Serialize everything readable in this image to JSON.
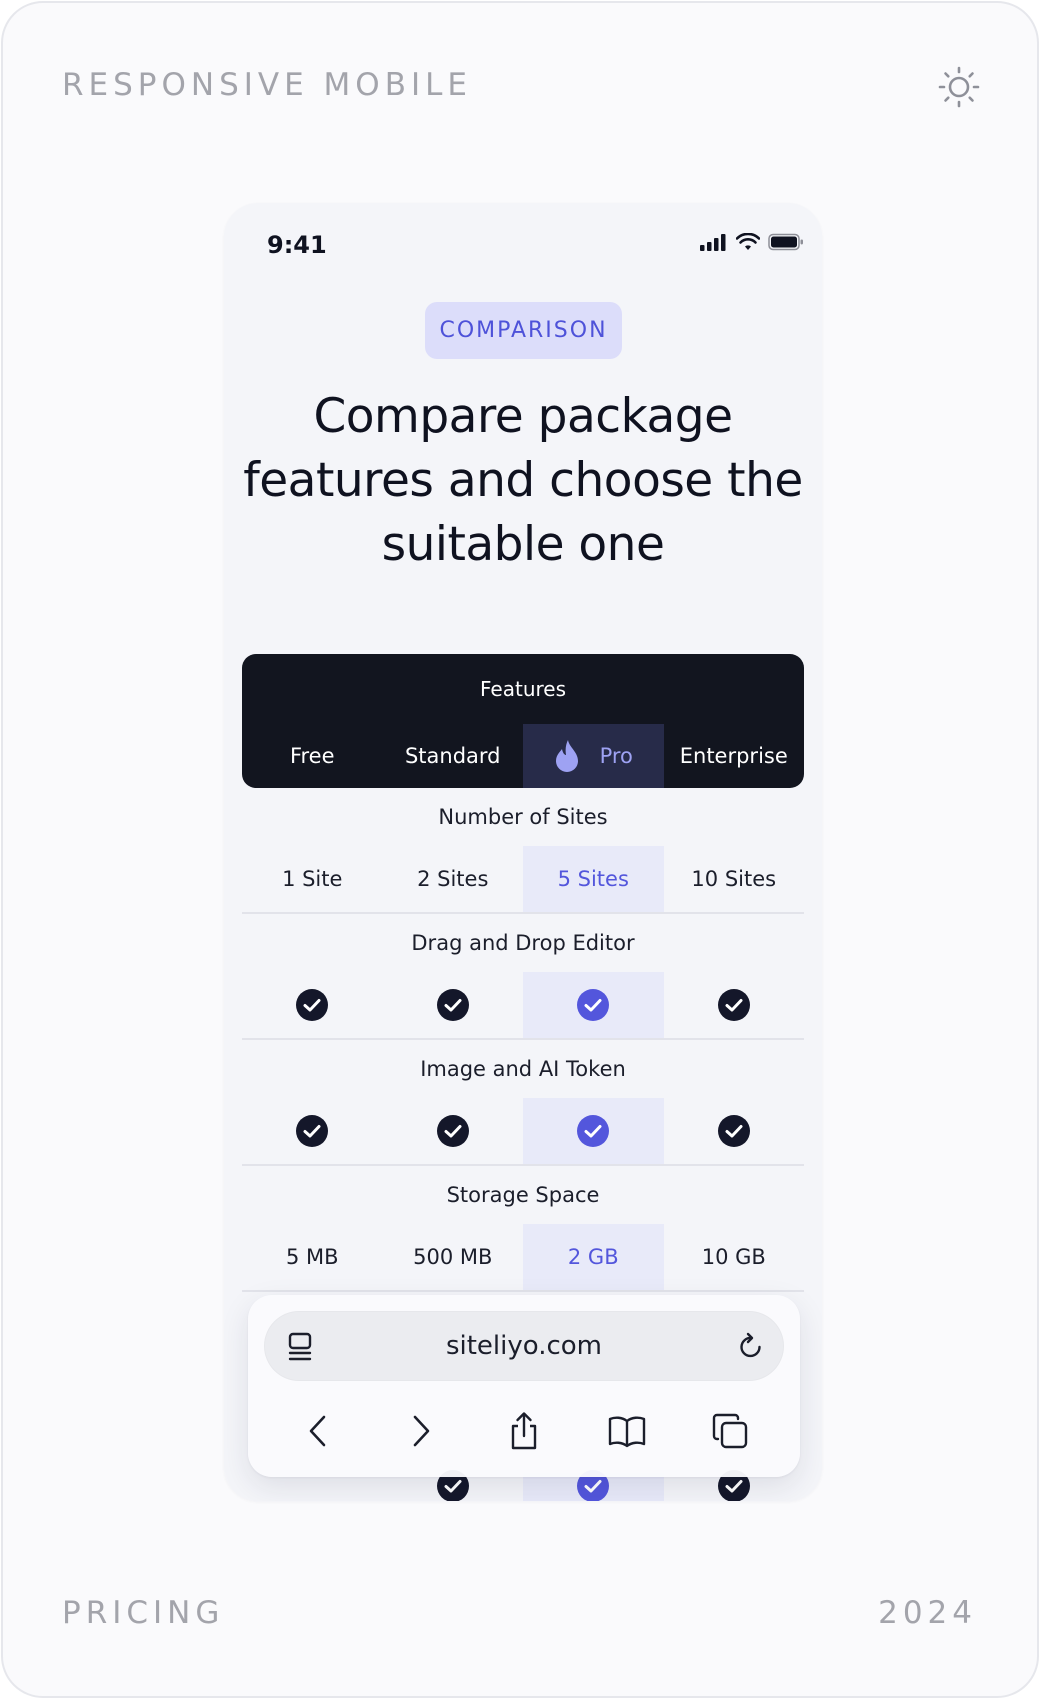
{
  "frame": {
    "top_left_label": "RESPONSIVE MOBILE",
    "bottom_left_label": "PRICING",
    "bottom_right_label": "2024",
    "theme_icon": "sun-icon"
  },
  "status_bar": {
    "time": "9:41",
    "icons": [
      "signal-icon",
      "wifi-icon",
      "battery-icon"
    ]
  },
  "hero": {
    "badge": "COMPARISON",
    "headline_lines": [
      "Compare package",
      "features and choose the",
      "suitable one"
    ]
  },
  "table": {
    "header_title": "Features",
    "plans": [
      "Free",
      "Standard",
      "Pro",
      "Enterprise"
    ],
    "highlighted_plan_index": 2,
    "highlight_icon": "flame-icon",
    "sections": [
      {
        "title": "Number of Sites",
        "type": "text",
        "values": [
          "1 Site",
          "2 Sites",
          "5 Sites",
          "10 Sites"
        ]
      },
      {
        "title": "Drag and Drop Editor",
        "type": "check",
        "values": [
          true,
          true,
          true,
          true
        ]
      },
      {
        "title": "Image and AI Token",
        "type": "check",
        "values": [
          true,
          true,
          true,
          true
        ]
      },
      {
        "title": "Storage Space",
        "type": "text",
        "values": [
          "5 MB",
          "500 MB",
          "2 GB",
          "10 GB"
        ]
      }
    ]
  },
  "browser": {
    "url": "siteliyo.com",
    "toolbar": [
      "back-icon",
      "forward-icon",
      "share-icon",
      "bookmarks-icon",
      "tabs-icon"
    ]
  },
  "colors": {
    "accent": "#5356dc",
    "dark": "#12151f",
    "highlight_bg": "#e8eaf9"
  }
}
